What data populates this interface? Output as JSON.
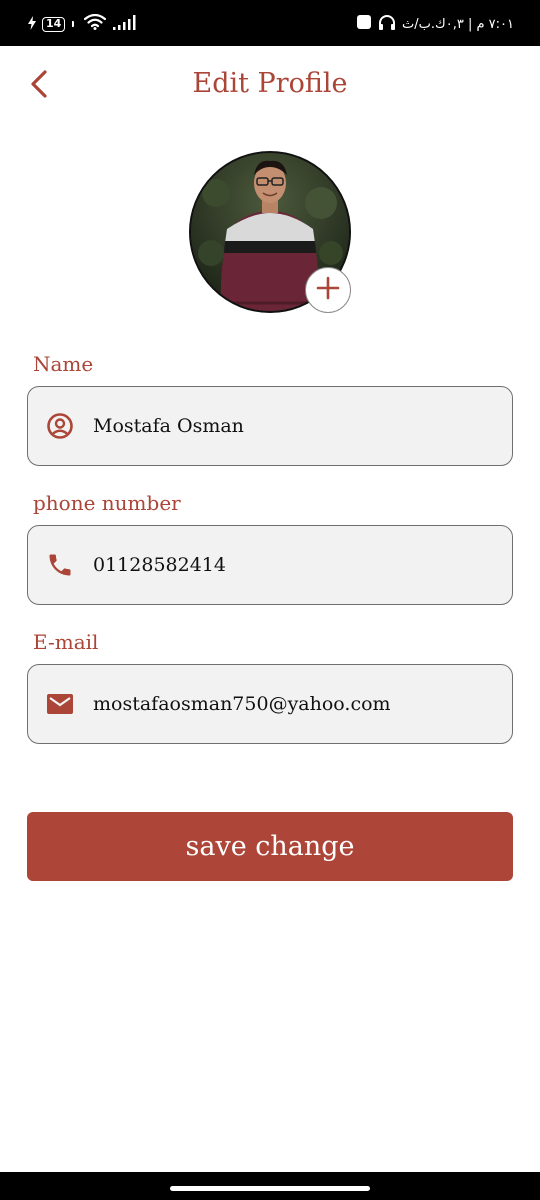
{
  "status_bar": {
    "battery_level": "14",
    "clock_text": "٧:٠١ م | ٠,٣ك.ب/ث",
    "icons": [
      "charging-icon",
      "battery-icon",
      "wifi-icon",
      "signal-icon",
      "headphones-icon",
      "notification-icon"
    ]
  },
  "header": {
    "title": "Edit Profile",
    "back_icon": "chevron-left-icon"
  },
  "profile": {
    "add_photo_icon": "plus-icon"
  },
  "form": {
    "name": {
      "label": "Name",
      "value": "Mostafa Osman",
      "icon": "account-circle-icon"
    },
    "phone": {
      "label": "phone number",
      "value": "01128582414",
      "icon": "phone-icon"
    },
    "email": {
      "label": "E-mail",
      "value": "mostafaosman750@yahoo.com",
      "icon": "mail-icon"
    }
  },
  "actions": {
    "save_label": "save change"
  },
  "colors": {
    "accent": "#ab4537",
    "button": "#ad4638",
    "field_bg": "#f2f2f2",
    "field_border": "#6f6f6f"
  }
}
